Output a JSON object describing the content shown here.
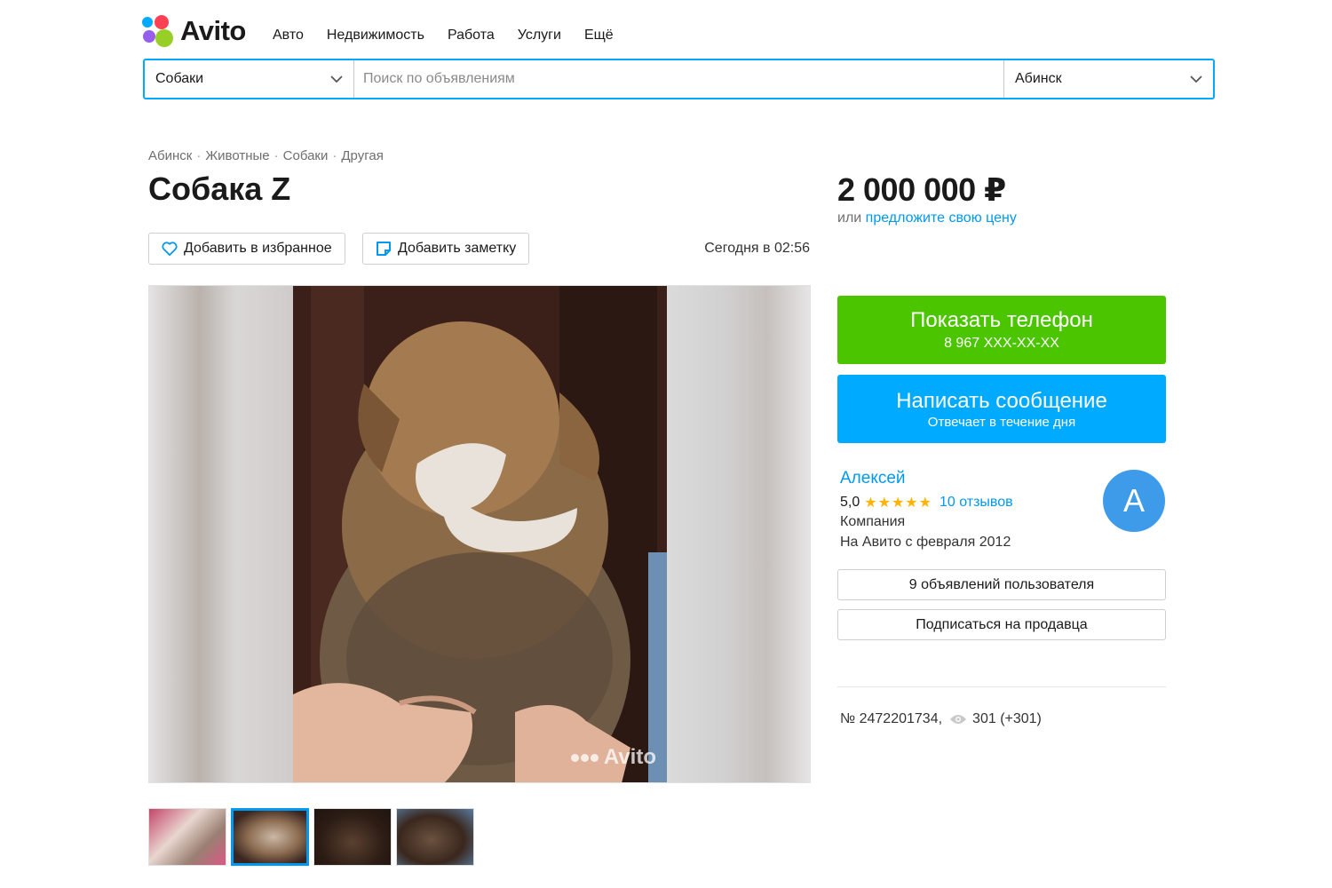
{
  "brand": {
    "name": "Avito",
    "colors": {
      "dot_blue": "#0af",
      "dot_red": "#ff4053",
      "dot_purple": "#965eeb",
      "dot_green": "#97cf26"
    }
  },
  "topnav": [
    "Авто",
    "Недвижимость",
    "Работа",
    "Услуги",
    "Ещё"
  ],
  "search": {
    "category": "Собаки",
    "placeholder": "Поиск по объявлениям",
    "city": "Абинск"
  },
  "breadcrumb": [
    "Абинск",
    "Животные",
    "Собаки",
    "Другая"
  ],
  "listing": {
    "title": "Собака Z",
    "favorite_label": "Добавить в избранное",
    "note_label": "Добавить заметку",
    "date": "Сегодня в 02:56",
    "watermark": "Avito",
    "thumbnail_count": 4,
    "active_thumbnail": 2
  },
  "price": {
    "value": "2 000 000 ₽",
    "offer_prefix": "или ",
    "offer_link": "предложите свою цену"
  },
  "actions": {
    "phone_title": "Показать телефон",
    "phone_number": "8 967 XXX-XX-XX",
    "message_title": "Написать сообщение",
    "message_subtitle": "Отвечает в течение дня"
  },
  "seller": {
    "name": "Алексей",
    "rating": "5,0",
    "stars": 5,
    "reviews": "10 отзывов",
    "type": "Компания",
    "since": "На Авито с февраля 2012",
    "avatar_letter": "А",
    "ads_button": "9 объявлений пользователя",
    "subscribe_button": "Подписаться на продавца"
  },
  "meta": {
    "id": "№ 2472201734,",
    "views": "301 (+301)"
  },
  "colors": {
    "accent_blue": "#00aaff",
    "phone_green": "#4bc500",
    "link_blue": "#0099f0",
    "star": "#ffb400"
  }
}
